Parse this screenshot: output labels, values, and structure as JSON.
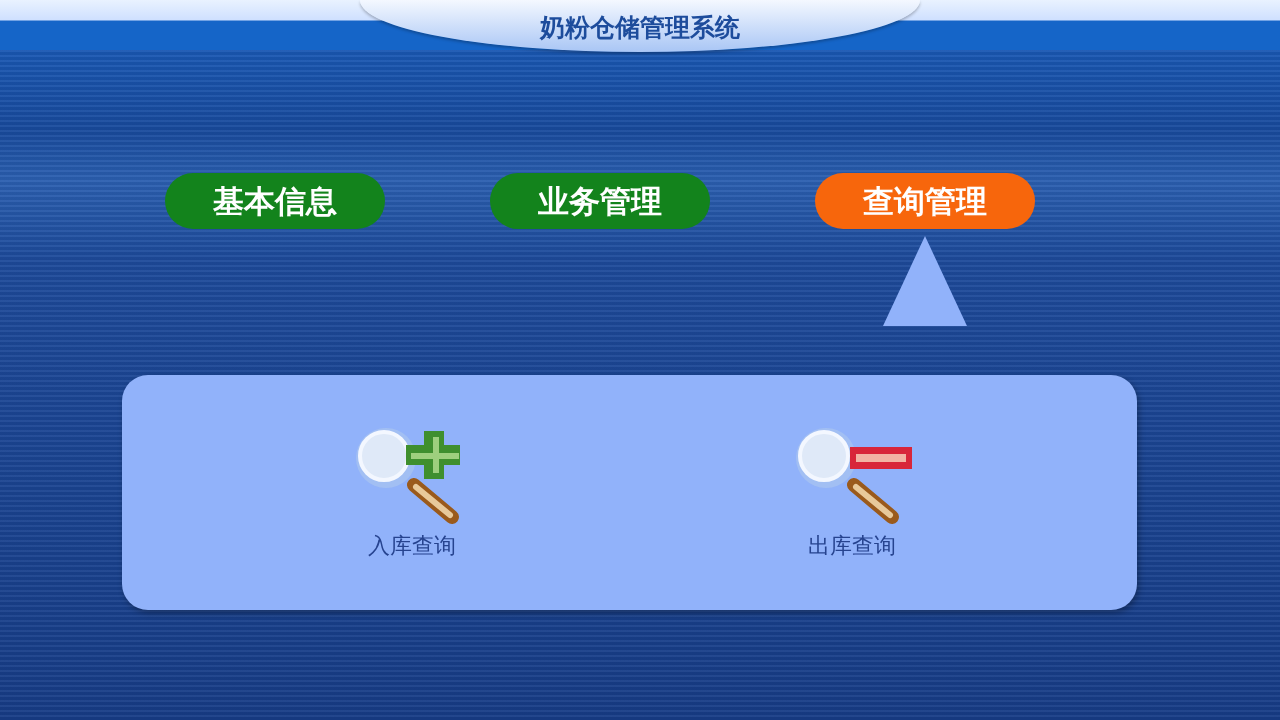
{
  "window": {
    "title": "奶粉仓储管理系统"
  },
  "tabs": [
    {
      "label": "基本信息",
      "selected": false
    },
    {
      "label": "业务管理",
      "selected": false
    },
    {
      "label": "查询管理",
      "selected": true
    }
  ],
  "panel": {
    "items": [
      {
        "label": "入库查询",
        "kind": "add"
      },
      {
        "label": "出库查询",
        "kind": "remove"
      }
    ]
  }
}
